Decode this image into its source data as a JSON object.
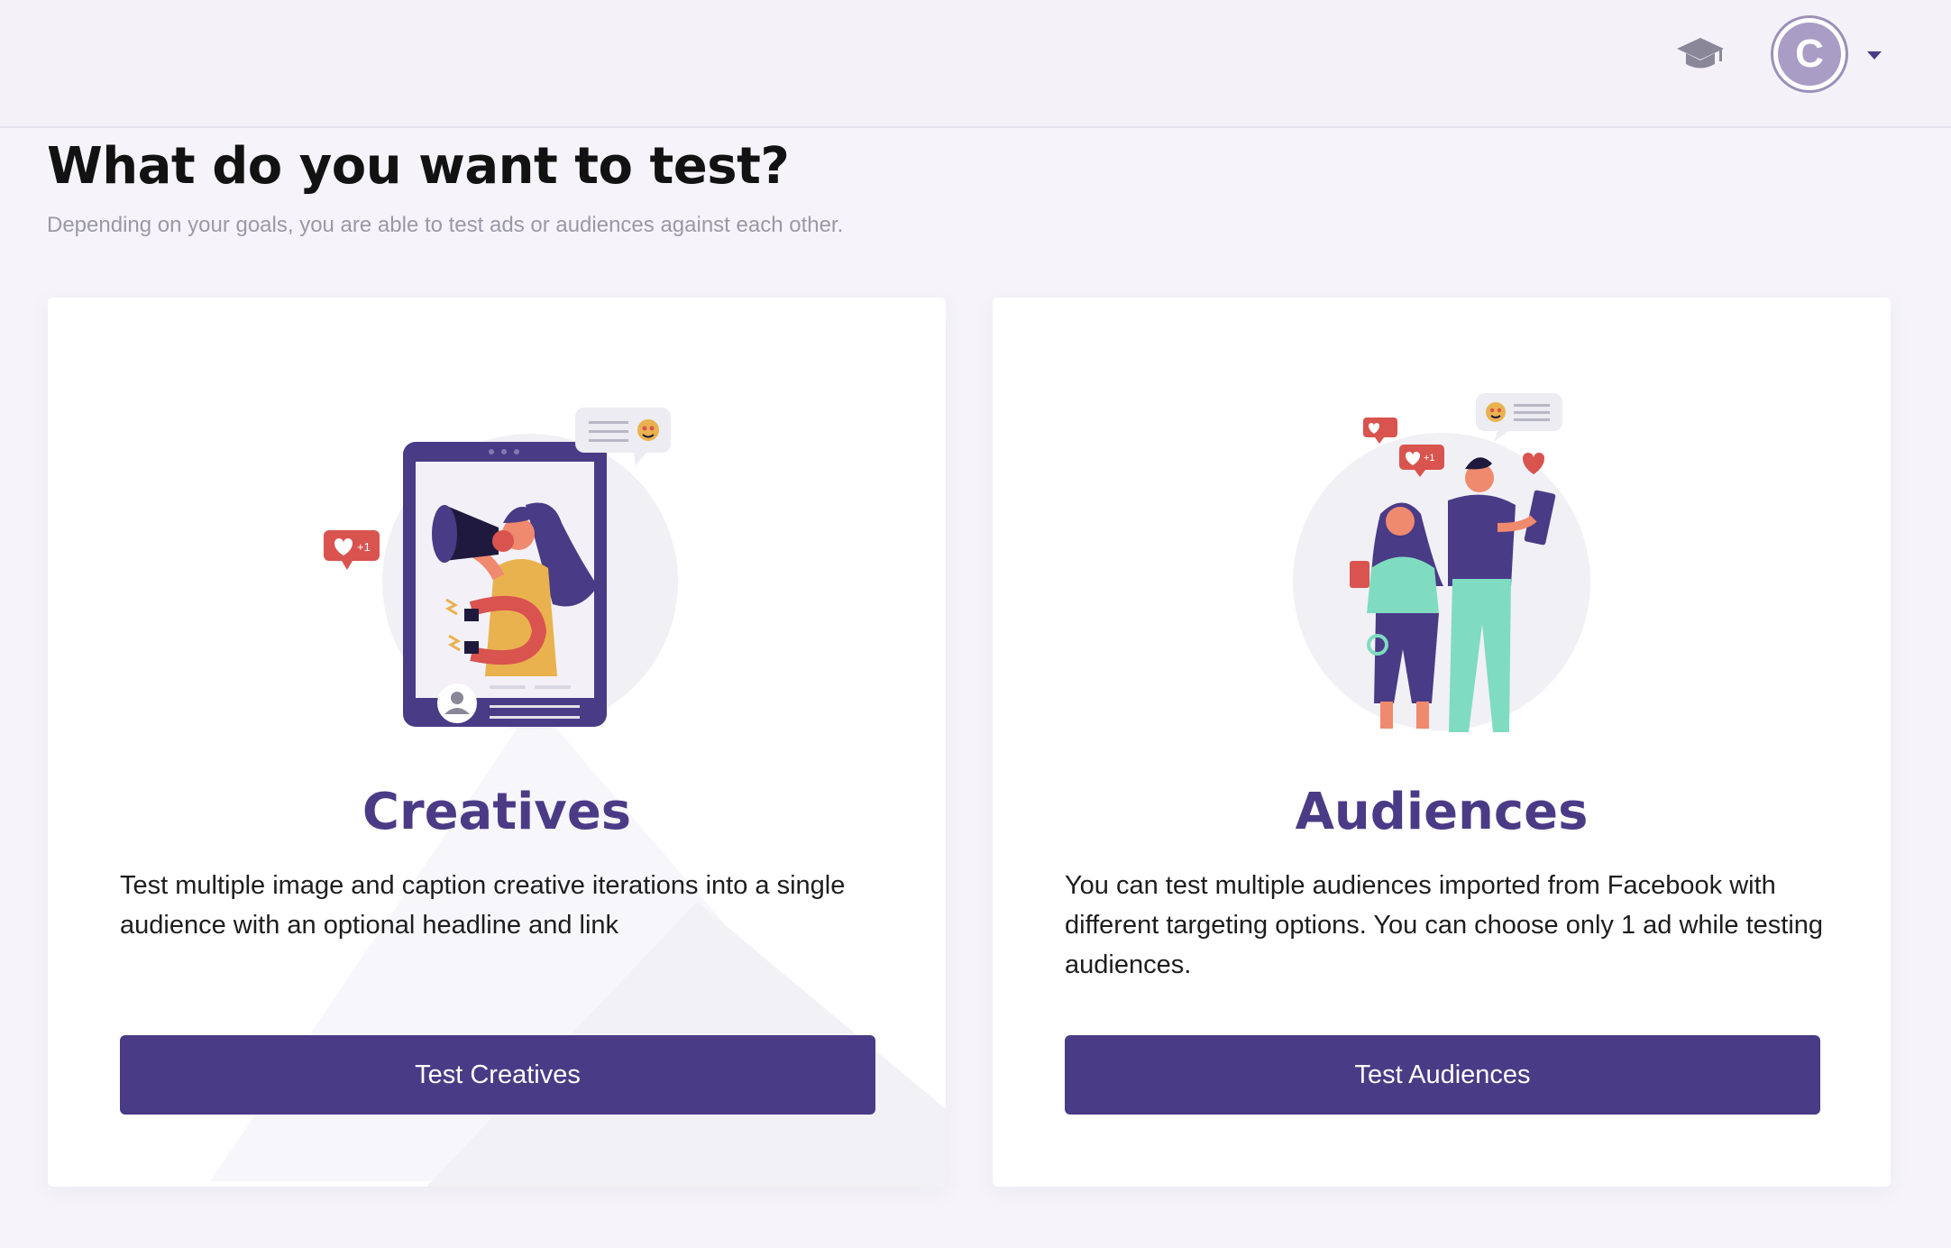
{
  "header": {
    "academy_icon": "graduation-cap-icon",
    "avatar_initial": "C",
    "menu_icon": "caret-down-icon"
  },
  "page": {
    "title": "What do you want to test?",
    "subtitle": "Depending on your goals, you are able to test ads or audiences against each other."
  },
  "cards": [
    {
      "title": "Creatives",
      "description": "Test multiple image and caption creative iterations into a single audience with an optional headline and link",
      "button_label": "Test Creatives",
      "illustration": "megaphone-woman-phone-illustration"
    },
    {
      "title": "Audiences",
      "description": "You can test multiple audiences imported from Facebook with different targeting options. You can choose only 1 ad while testing audiences.",
      "button_label": "Test Audiences",
      "illustration": "two-people-audience-illustration"
    }
  ],
  "colors": {
    "primary": "#4a3b86",
    "background": "#f6f4fa",
    "notification_red": "#d9534f",
    "teal": "#7fdcc0",
    "skin": "#f08a6e",
    "dress": "#e9b24f"
  }
}
